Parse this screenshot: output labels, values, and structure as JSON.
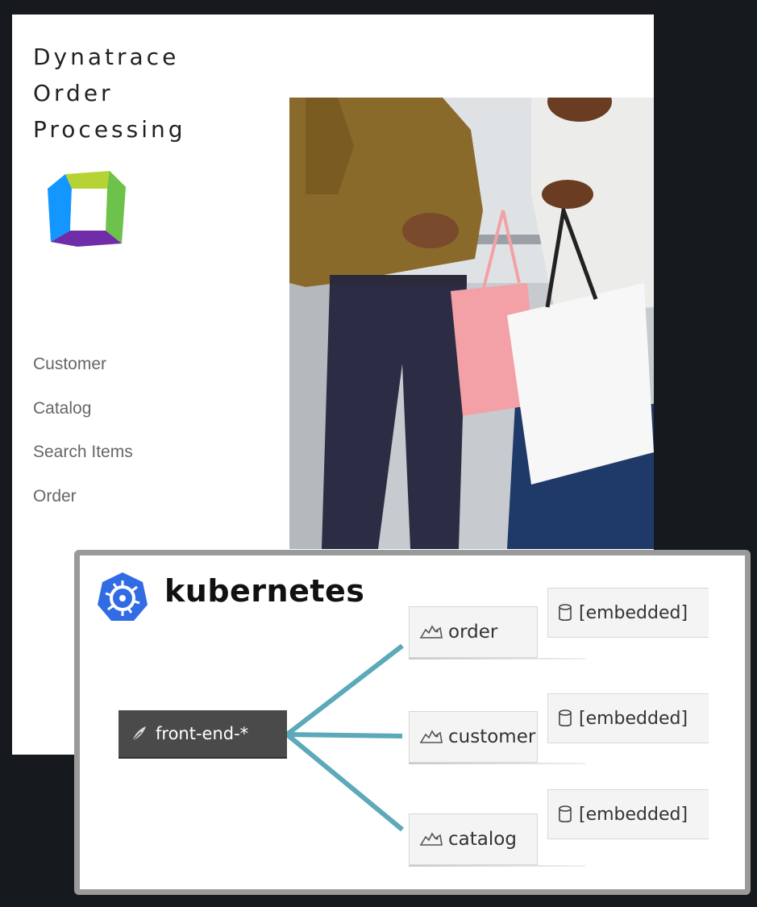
{
  "app": {
    "title_lines": [
      "Dynatrace",
      "Order",
      "Processing"
    ],
    "logo_icon": "dynatrace-logo",
    "nav": [
      {
        "label": "Customer"
      },
      {
        "label": "Catalog"
      },
      {
        "label": "Search Items"
      },
      {
        "label": "Order"
      }
    ],
    "hero_image": "shoppers-with-bags-photo"
  },
  "diagram": {
    "platform_label": "kubernetes",
    "platform_icon": "kubernetes-helm-icon",
    "edge_color": "#5ba9b9",
    "frontend": {
      "label": "front-end-*",
      "icon": "feather-icon"
    },
    "services": [
      {
        "label": "order",
        "icon": "tomcat-icon",
        "db_label": "[embedded]",
        "db_icon": "database-icon"
      },
      {
        "label": "customer",
        "icon": "tomcat-icon",
        "db_label": "[embedded]",
        "db_icon": "database-icon"
      },
      {
        "label": "catalog",
        "icon": "tomcat-icon",
        "db_label": "[embedded]",
        "db_icon": "database-icon"
      }
    ]
  }
}
